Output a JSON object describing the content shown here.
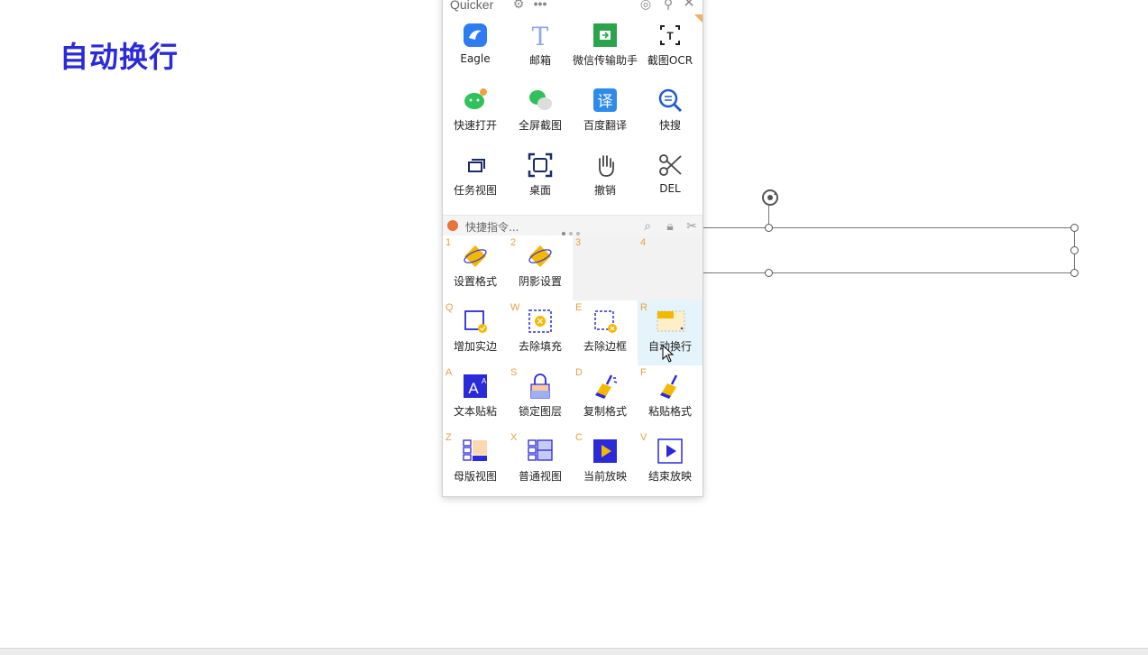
{
  "slide": {
    "title": "自动换行"
  },
  "panel": {
    "app_title": "Quicker",
    "top_grid": [
      {
        "label": "Eagle",
        "icon": "eagle-icon"
      },
      {
        "label": "邮箱",
        "icon": "mail-text-icon"
      },
      {
        "label": "微信传输助手",
        "icon": "wechat-transfer-icon"
      },
      {
        "label": "截图OCR",
        "icon": "ocr-icon"
      },
      {
        "label": "快速打开",
        "icon": "wechat-icon"
      },
      {
        "label": "全屏截图",
        "icon": "wechat-screenshot-icon"
      },
      {
        "label": "百度翻译",
        "icon": "translate-icon"
      },
      {
        "label": "快搜",
        "icon": "quick-search-icon"
      },
      {
        "label": "任务视图",
        "icon": "task-view-icon"
      },
      {
        "label": "桌面",
        "icon": "desktop-icon"
      },
      {
        "label": "撤销",
        "icon": "hand-icon"
      },
      {
        "label": "DEL",
        "icon": "scissors-icon"
      }
    ],
    "command_bar": {
      "placeholder": "快捷指令..."
    },
    "bottom_grid": [
      {
        "key": "1",
        "label": "设置格式",
        "icon": "format-diamond-icon"
      },
      {
        "key": "2",
        "label": "阴影设置",
        "icon": "shadow-diamond-icon"
      },
      {
        "key": "3",
        "label": "",
        "icon": ""
      },
      {
        "key": "4",
        "label": "",
        "icon": ""
      },
      {
        "key": "Q",
        "label": "增加实边",
        "icon": "add-border-icon"
      },
      {
        "key": "W",
        "label": "去除填充",
        "icon": "remove-fill-icon"
      },
      {
        "key": "E",
        "label": "去除边框",
        "icon": "remove-border-icon"
      },
      {
        "key": "R",
        "label": "自动换行",
        "icon": "auto-wrap-icon"
      },
      {
        "key": "A",
        "label": "文本贴粘",
        "icon": "text-paste-icon"
      },
      {
        "key": "S",
        "label": "锁定图层",
        "icon": "lock-layer-icon"
      },
      {
        "key": "D",
        "label": "复制格式",
        "icon": "copy-format-icon"
      },
      {
        "key": "F",
        "label": "粘贴格式",
        "icon": "paste-format-icon"
      },
      {
        "key": "Z",
        "label": "母版视图",
        "icon": "master-view-icon"
      },
      {
        "key": "X",
        "label": "普通视图",
        "icon": "normal-view-icon"
      },
      {
        "key": "C",
        "label": "当前放映",
        "icon": "play-current-icon"
      },
      {
        "key": "V",
        "label": "结束放映",
        "icon": "end-show-icon"
      }
    ]
  },
  "colors": {
    "accent": "#2a2ad8",
    "key": "#e8a040",
    "highlight": "#e4f4fa"
  }
}
